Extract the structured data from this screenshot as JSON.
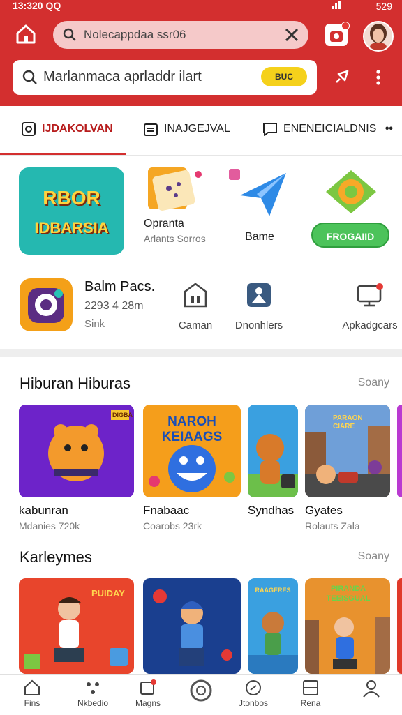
{
  "status": {
    "time": "13:320 QQ",
    "right": "529"
  },
  "header": {
    "top_search_placeholder": "Nolecappdaa ssr06",
    "main_search_placeholder": "Marlanmaca aprladdr ilart",
    "badge": "BUC"
  },
  "tabs": [
    {
      "label": "IJDAKOLVAN"
    },
    {
      "label": "INAJGEJVAL"
    },
    {
      "label": "ENENEICIALDNIS"
    }
  ],
  "featured": {
    "t1": "RBOR",
    "t2": "IDBARSIA"
  },
  "apps_row1": [
    {
      "label": "Opranta",
      "sub": "Arlants Sorros"
    },
    {
      "label": "Bame"
    },
    {
      "button": "FROGAIID"
    }
  ],
  "apps_row2": {
    "title": "Balm Pacs.",
    "sub": "2293 4 28m",
    "meta": "Sink",
    "items": [
      {
        "label": "Caman"
      },
      {
        "label": "Dnonhlers"
      },
      {
        "label": "Apkadgcars"
      }
    ]
  },
  "section1": {
    "title": "Hiburan Hiburas",
    "more": "Soany",
    "cards": [
      {
        "label": "kabunran",
        "sub": "Mdanies 720k",
        "art": "DIGBA"
      },
      {
        "label": "Fnabaac",
        "sub": "Coarobs 23rk",
        "art": "NAROH KEIAAGS"
      },
      {
        "label": "Syndhas",
        "sub": ""
      },
      {
        "label": "Gyates",
        "sub": "Rolauts Zala",
        "art": "PARAON CIARE"
      }
    ]
  },
  "section2": {
    "title": "Karleymes",
    "more": "Soany",
    "art1": "PUIDAY",
    "art3": "RAAGERES",
    "art4": "PIRANDA TEEISGUAL"
  },
  "bottom_nav": [
    {
      "label": "Fins"
    },
    {
      "label": "Nkbedio"
    },
    {
      "label": "Magns"
    },
    {
      "label": ""
    },
    {
      "label": "Jtonbos"
    },
    {
      "label": "Rena"
    },
    {
      "label": ""
    }
  ],
  "colors": {
    "brand": "#d32f2f",
    "accent_green": "#4cc35a",
    "badge_yellow": "#f5d11b"
  }
}
